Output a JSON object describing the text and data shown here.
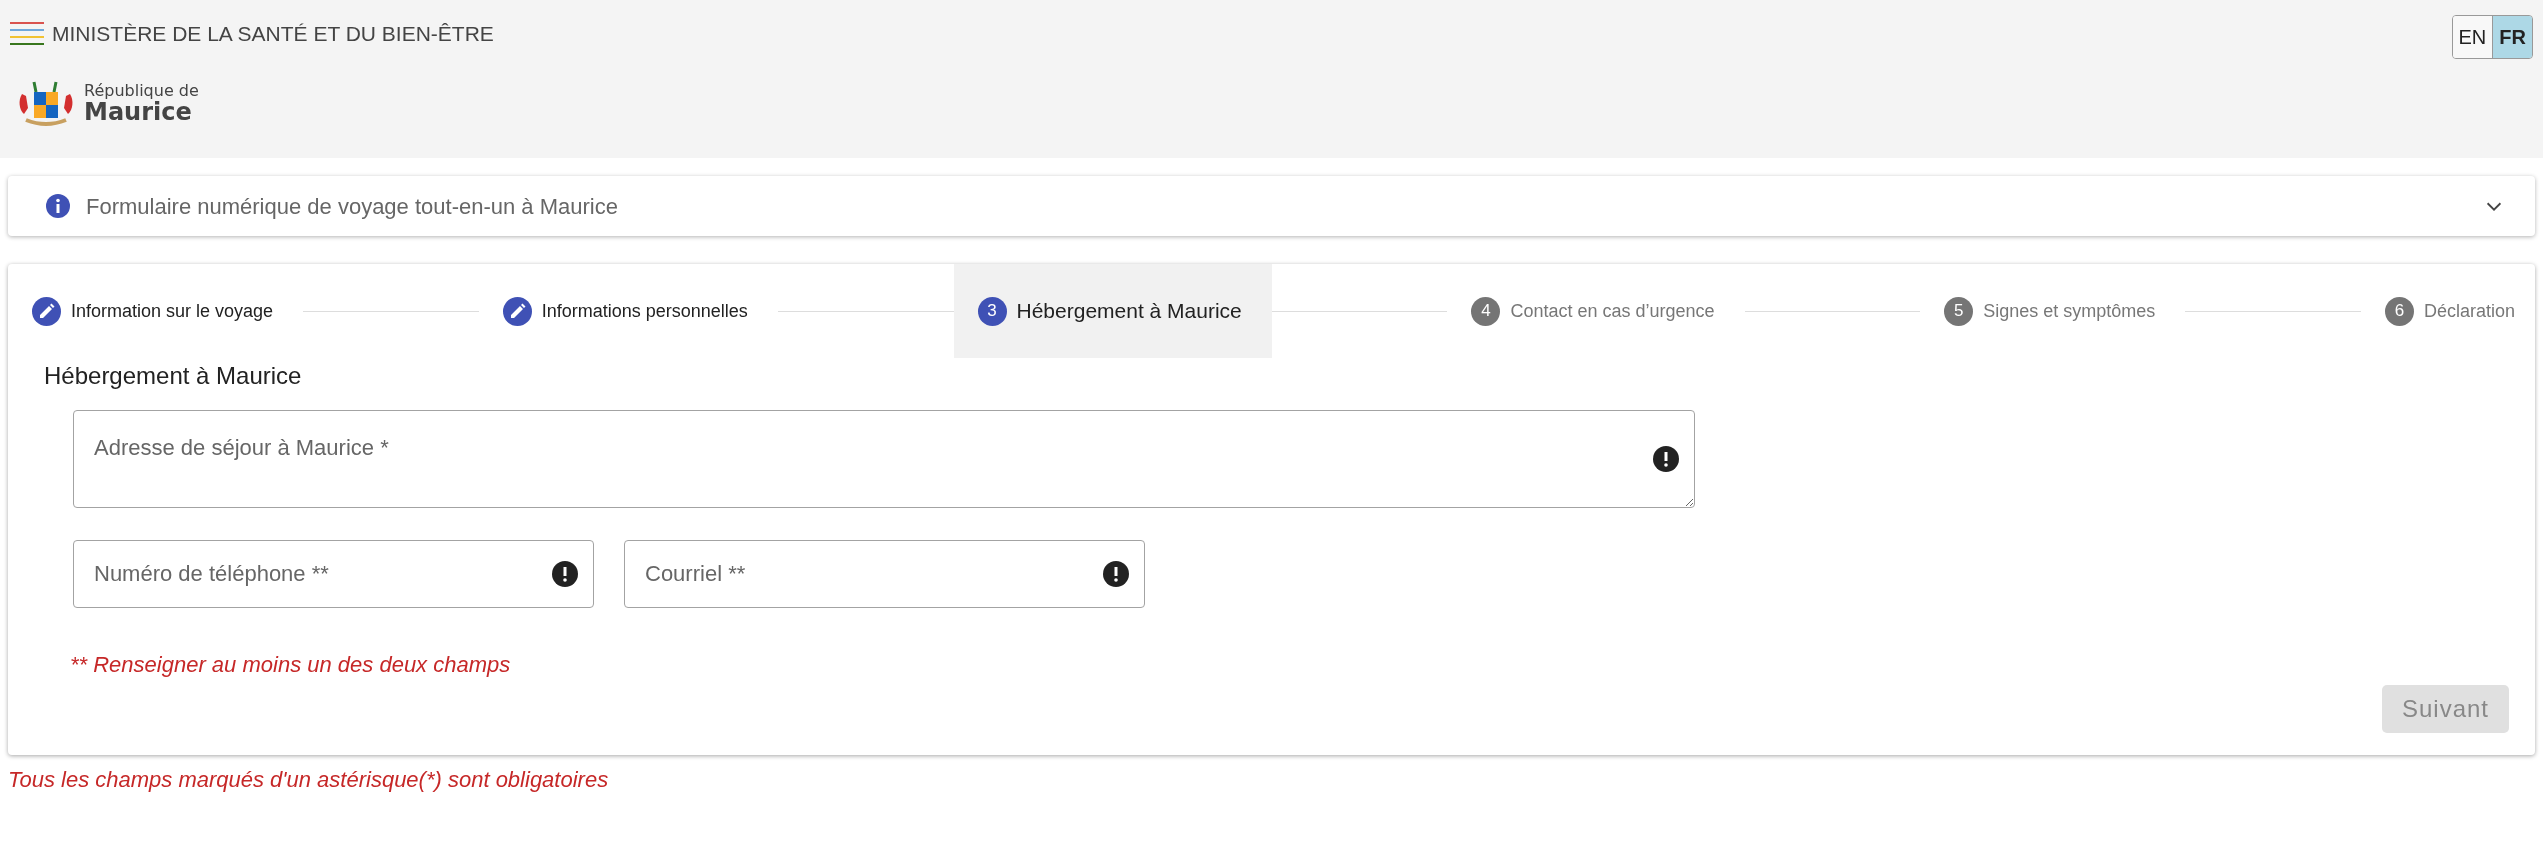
{
  "header": {
    "ministry": "MINISTÈRE DE LA SANTÉ ET DU BIEN-ÊTRE",
    "logo_line_1": "République de",
    "logo_line_2": "Maurice",
    "languages": [
      {
        "label": "EN",
        "selected": false
      },
      {
        "label": "FR",
        "selected": true
      }
    ]
  },
  "info_panel": {
    "title": "Formulaire numérique de voyage tout-en-un à Maurice",
    "expanded": false
  },
  "stepper": {
    "steps": [
      {
        "label": "Information sur le voyage",
        "completed": true,
        "selected": false
      },
      {
        "label": "Informations personnelles",
        "completed": true,
        "selected": false
      },
      {
        "number": "3",
        "label": "Hébergement à Maurice",
        "completed": false,
        "selected": true
      },
      {
        "number": "4",
        "label": "Contact en cas d’urgence",
        "completed": false,
        "selected": false
      },
      {
        "number": "5",
        "label": "Signes et symptômes",
        "completed": false,
        "selected": false
      },
      {
        "number": "6",
        "label": "Déclaration",
        "completed": false,
        "selected": false
      }
    ]
  },
  "form": {
    "heading": "Hébergement à Maurice",
    "fields": [
      {
        "kind": "textarea",
        "placeholder": "Adresse de séjour à Maurice *",
        "invalid": true
      },
      {
        "kind": "input",
        "placeholder": "Numéro de téléphone **",
        "invalid": true
      },
      {
        "kind": "input",
        "placeholder": "Courriel **",
        "invalid": true
      }
    ],
    "hint": "** Renseigner au moins un des deux champs",
    "next_button": {
      "label": "Suivant",
      "disabled": true
    }
  },
  "footer_note": "Tous les champs marqués d'un astérisque(*) sont obligatoires"
}
